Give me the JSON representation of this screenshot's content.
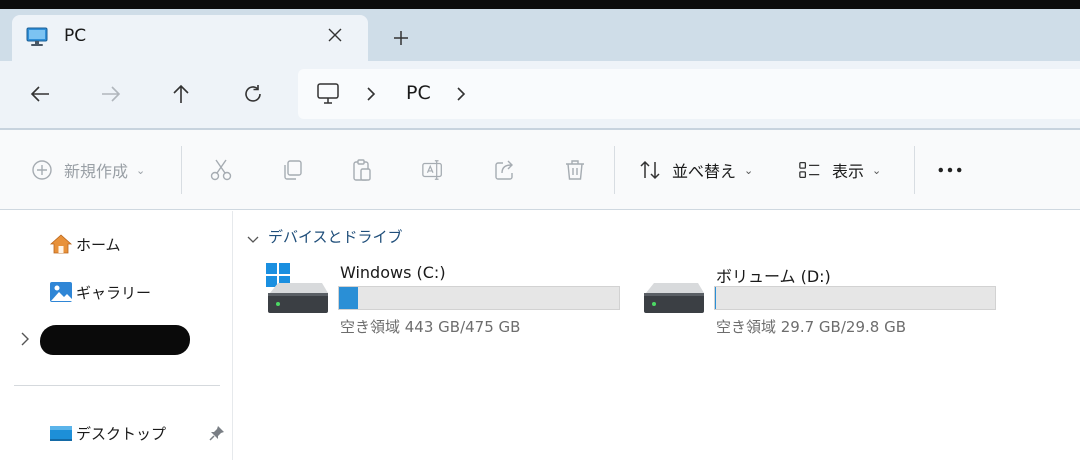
{
  "tab": {
    "title": "PC",
    "icon": "monitor-icon",
    "close_icon": "close-icon",
    "new_tab_icon": "plus-icon"
  },
  "nav": {
    "back_icon": "arrow-left-icon",
    "forward_icon": "arrow-right-icon",
    "up_icon": "arrow-up-icon",
    "refresh_icon": "refresh-icon",
    "breadcrumb": [
      "PC"
    ]
  },
  "toolbar": {
    "new_label": "新規作成",
    "sort_label": "並べ替え",
    "view_label": "表示",
    "icons": [
      "plus-circle-icon",
      "cut-icon",
      "copy-icon",
      "paste-icon",
      "rename-icon",
      "share-icon",
      "delete-icon",
      "sort-icon",
      "view-icon",
      "more-icon"
    ]
  },
  "sidebar": {
    "items": [
      {
        "label": "ホーム",
        "icon": "home-icon"
      },
      {
        "label": "ギャラリー",
        "icon": "gallery-icon"
      },
      {
        "label": "デスクトップ",
        "icon": "desktop-folder-icon"
      }
    ]
  },
  "content": {
    "group_title": "デバイスとドライブ",
    "drives": [
      {
        "name": "Windows (C:)",
        "free_text": "空き領域 443 GB/475 GB",
        "used_fraction": 0.067,
        "icon": "windows-drive-icon"
      },
      {
        "name": "ボリューム (D:)",
        "free_text": "空き領域 29.7 GB/29.8 GB",
        "used_fraction": 0.003,
        "icon": "drive-icon"
      }
    ]
  },
  "colors": {
    "accent": "#2a8fd6",
    "tabstrip": "#cfdde8",
    "navbar": "#eef3f8"
  }
}
